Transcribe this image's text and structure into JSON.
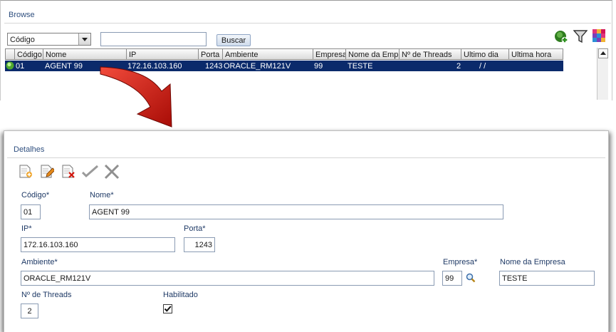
{
  "browse": {
    "title": "Browse",
    "search_field": {
      "selected": "Código",
      "value": ""
    },
    "search_button": "Buscar",
    "toolbar_icons": [
      "add-icon",
      "filter-icon",
      "grid-layout-icon"
    ],
    "columns": [
      "Código",
      "Nome",
      "IP",
      "Porta",
      "Ambiente",
      "Empresa",
      "Nome da Empres",
      "Nº de Threads",
      "Ultimo dia",
      "Ultima hora"
    ],
    "row": {
      "status_color": "#6cc644",
      "codigo": "01",
      "nome": "AGENT 99",
      "ip": "172.16.103.160",
      "porta": "1243",
      "ambiente": "ORACLE_RM121V",
      "empresa": "99",
      "nome_empresa": "TESTE",
      "threads": "2",
      "ultimo_dia": "/ /",
      "ultima_hora": ""
    }
  },
  "details": {
    "title": "Detalhes",
    "toolbar_icons": [
      "new-record-icon",
      "edit-record-icon",
      "delete-record-icon",
      "confirm-icon",
      "cancel-icon"
    ],
    "codigo": {
      "label": "Código*",
      "value": "01"
    },
    "nome": {
      "label": "Nome*",
      "value": "AGENT 99"
    },
    "ip": {
      "label": "IP*",
      "value": "172.16.103.160"
    },
    "porta": {
      "label": "Porta*",
      "value": "1243"
    },
    "ambiente": {
      "label": "Ambiente*",
      "value": "ORACLE_RM121V"
    },
    "empresa": {
      "label": "Empresa*",
      "value": "99"
    },
    "nome_empresa": {
      "label": "Nome da Empresa",
      "value": "TESTE"
    },
    "threads": {
      "label": "Nº de Threads",
      "value": "2"
    },
    "habilitado": {
      "label": "Habilitado",
      "checked": true
    }
  },
  "colors": {
    "accent": "#0b2a6b",
    "arrow": "#d2140a"
  }
}
